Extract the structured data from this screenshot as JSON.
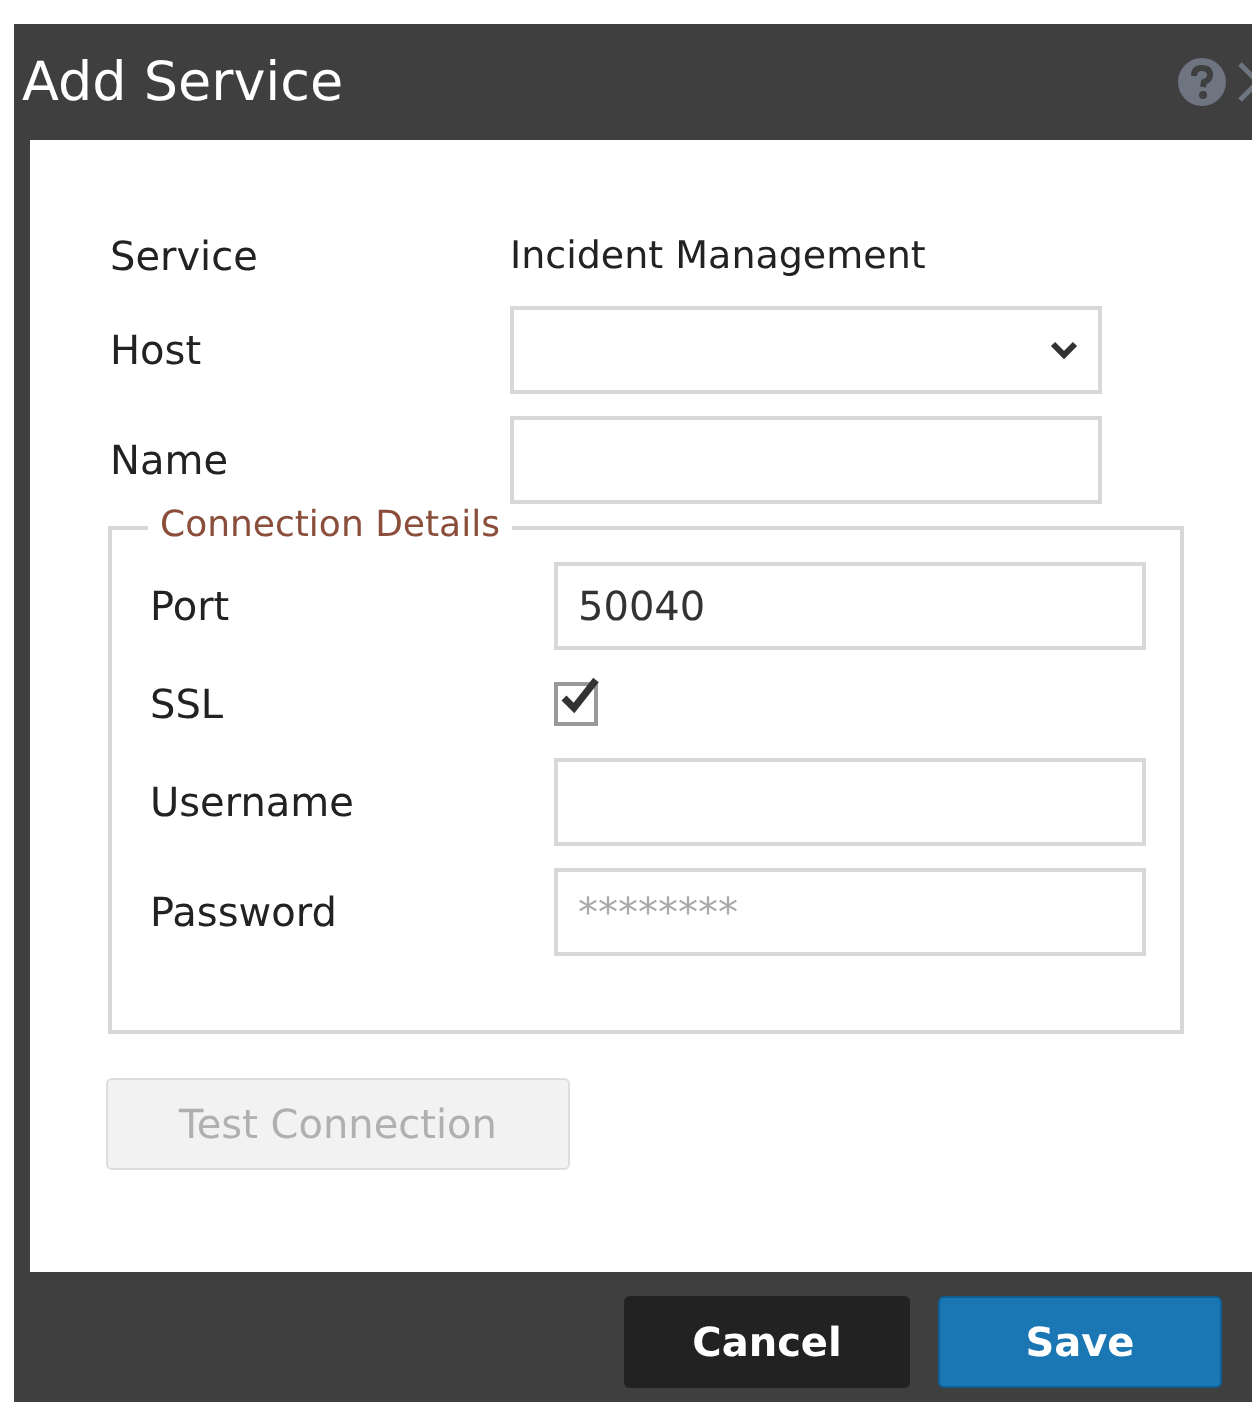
{
  "window": {
    "title": "Add Service"
  },
  "fields": [
    {
      "kind": "text",
      "label": "Service",
      "value": "Incident Management"
    },
    {
      "kind": "select",
      "label": "Host"
    },
    {
      "kind": "input",
      "label": "Name"
    }
  ],
  "connection_details": {
    "legend": "Connection Details",
    "fields": [
      {
        "kind": "input",
        "label": "Port",
        "value": "50040"
      },
      {
        "kind": "checkbox",
        "label": "SSL",
        "checked": true
      },
      {
        "kind": "input",
        "label": "Username"
      },
      {
        "kind": "input",
        "label": "Password",
        "placeholder": "********"
      }
    ]
  },
  "test_button": {
    "label": "Test Connection",
    "disabled": true
  },
  "buttons": [
    {
      "label": "Cancel",
      "kind": "secondary"
    },
    {
      "label": "Save",
      "kind": "primary"
    }
  ]
}
